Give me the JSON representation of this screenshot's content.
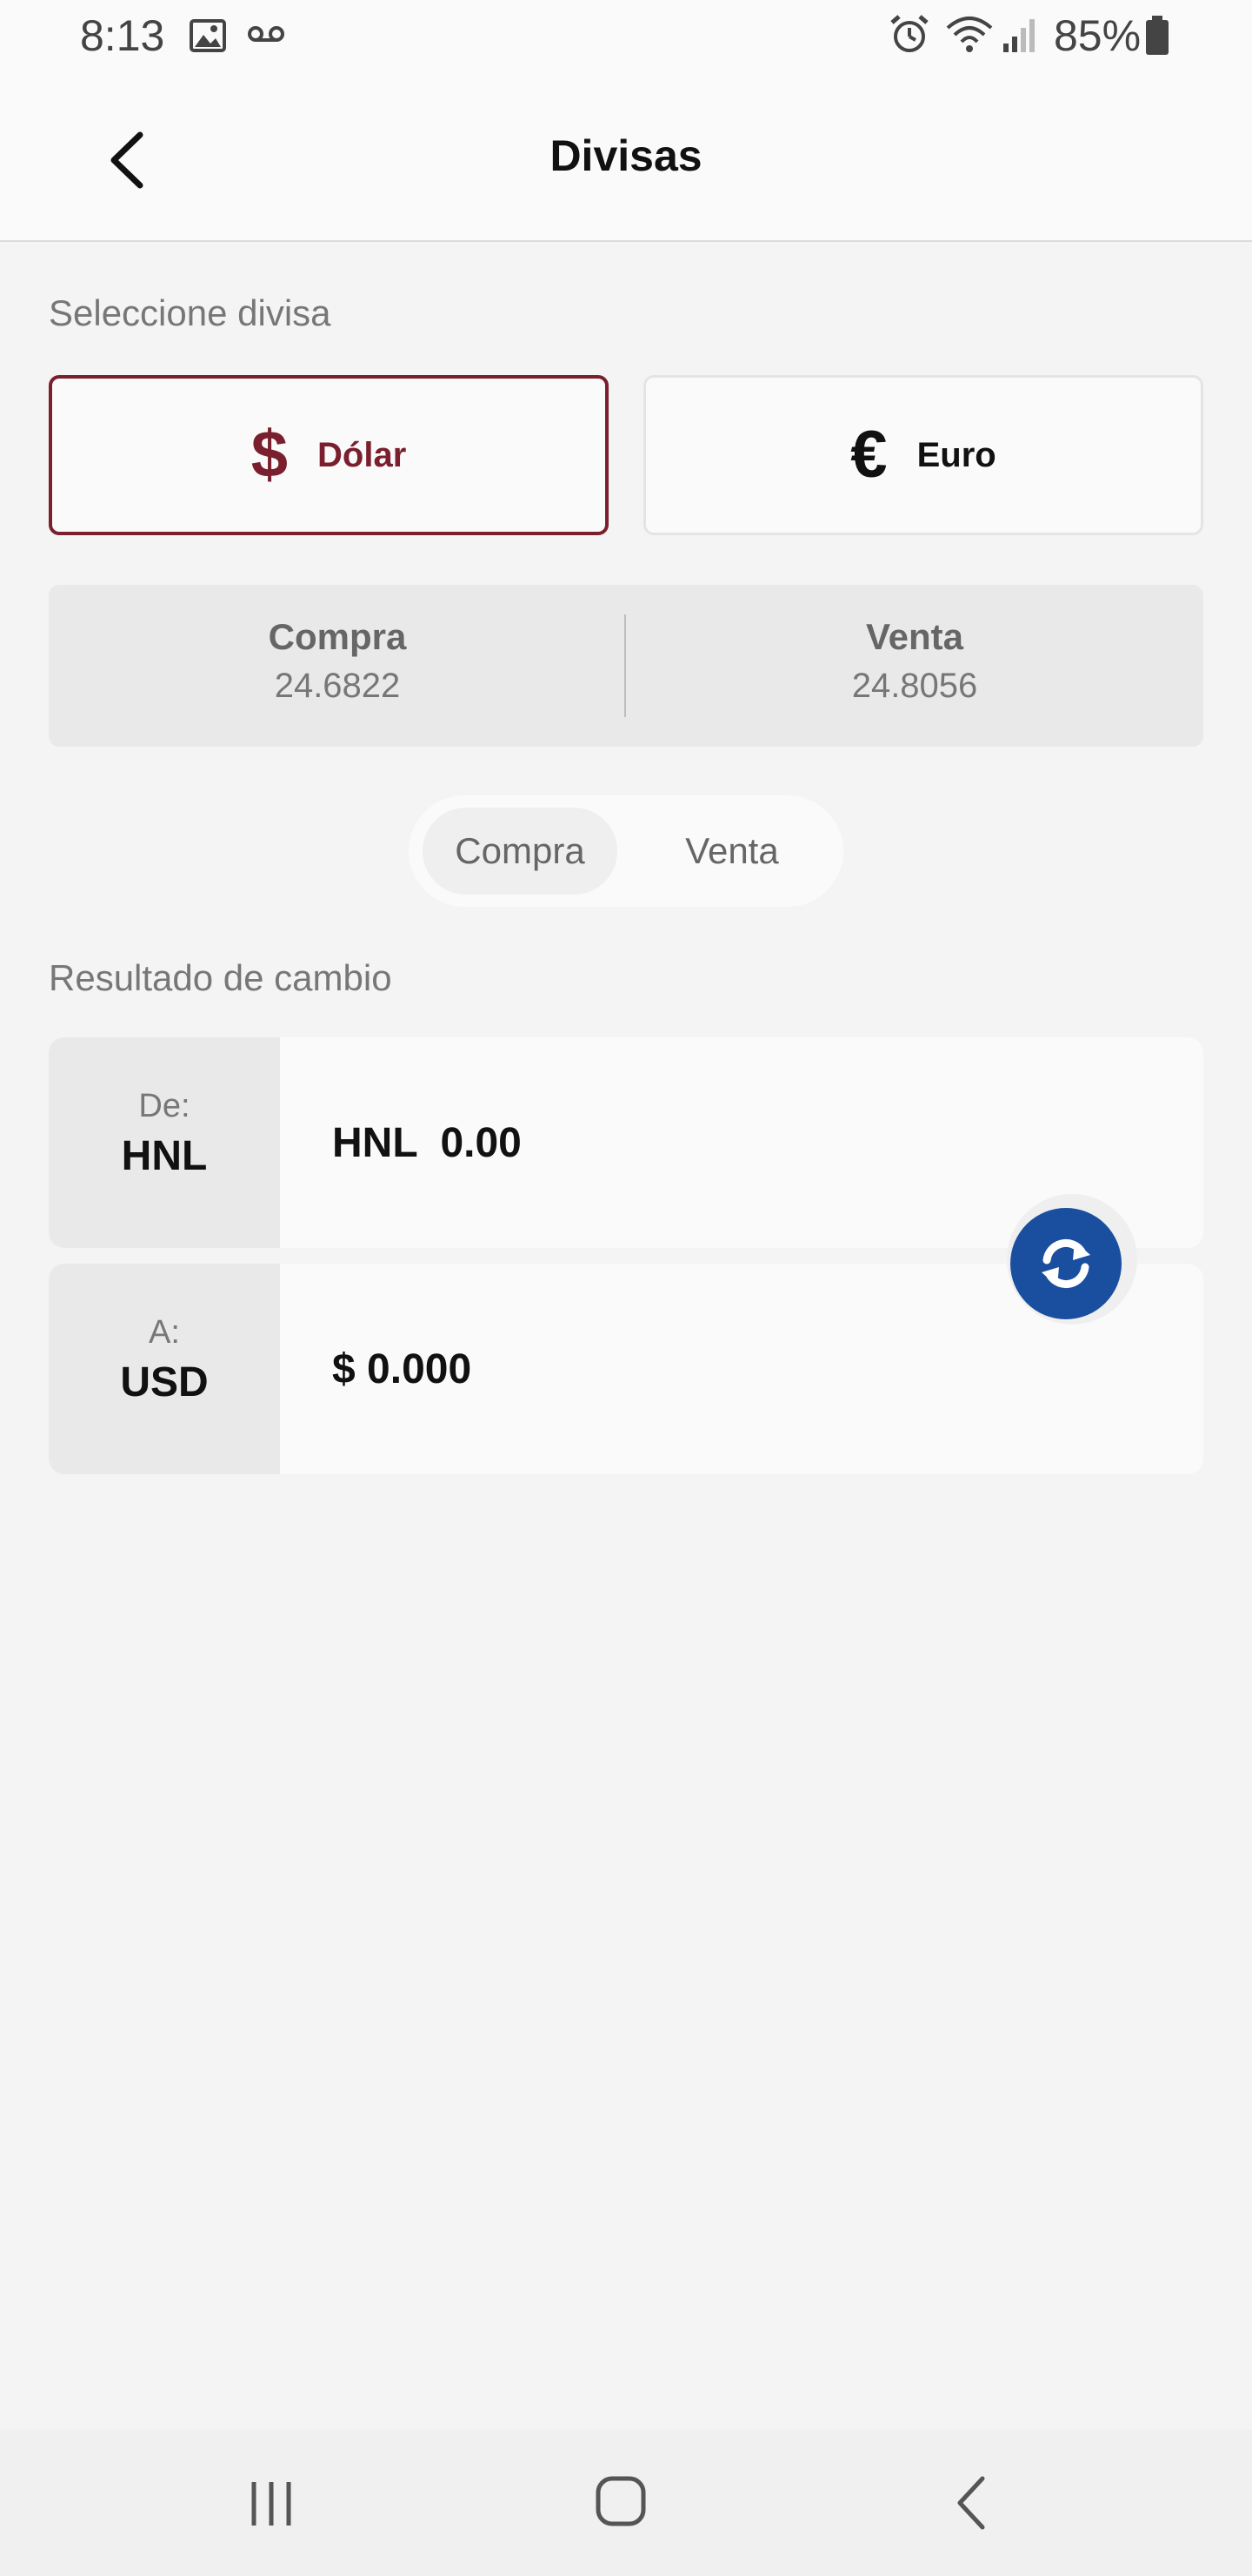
{
  "status": {
    "time": "8:13",
    "battery": "85%",
    "icons": [
      "image-icon",
      "voicemail-icon",
      "alarm-icon",
      "wifi-icon",
      "signal-icon",
      "battery-icon"
    ]
  },
  "header": {
    "title": "Divisas",
    "back_icon": "chevron-left-icon"
  },
  "currency_select": {
    "label": "Seleccione divisa",
    "options": [
      {
        "symbol": "$",
        "label": "Dólar",
        "active": true
      },
      {
        "symbol": "€",
        "label": "Euro",
        "active": false
      }
    ]
  },
  "rates": {
    "buy": {
      "label": "Compra",
      "value": "24.6822"
    },
    "sell": {
      "label": "Venta",
      "value": "24.8056"
    }
  },
  "mode_toggle": {
    "options": [
      "Compra",
      "Venta"
    ],
    "selected": "Compra"
  },
  "result": {
    "label": "Resultado de cambio",
    "from": {
      "prefix": "De:",
      "code": "HNL",
      "amount": "HNL  0.00"
    },
    "to": {
      "prefix": "A:",
      "code": "USD",
      "amount": "$ 0.000"
    },
    "swap_icon": "swap-refresh-icon"
  },
  "colors": {
    "accent": "#7a1f2e",
    "swap_button": "#1a4fa0",
    "background": "#f4f4f4"
  }
}
